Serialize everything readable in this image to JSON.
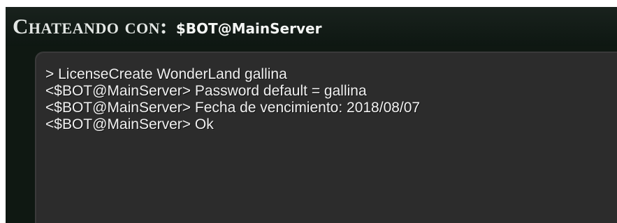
{
  "window": {
    "title_prefix": "Chateando con:",
    "title_user": "$BOT@MainServer"
  },
  "chat": {
    "lines": [
      "> LicenseCreate WonderLand gallina",
      "<$BOT@MainServer> Password default = gallina",
      "<$BOT@MainServer> Fecha de vencimiento: 2018/08/07",
      "<$BOT@MainServer> Ok"
    ]
  },
  "colors": {
    "frame_background": "#0f1812",
    "panel_background": "#2c2c2c",
    "text": "#f0f0f0"
  }
}
